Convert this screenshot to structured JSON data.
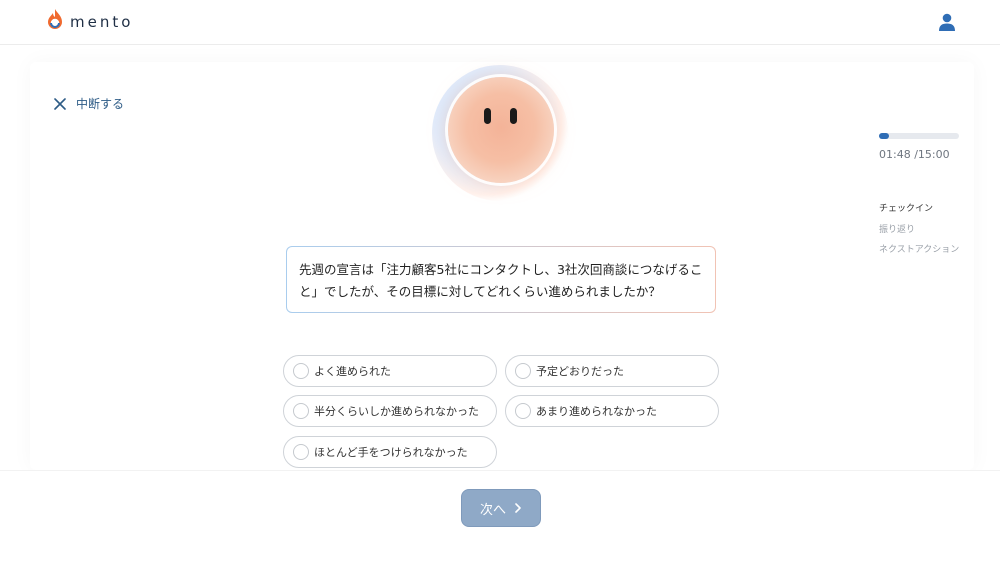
{
  "header": {
    "logo_text": "mento",
    "logo_icon": "mento-flame-logo",
    "user_icon": "user-icon"
  },
  "abort": {
    "label": "中断する",
    "icon": "close-icon"
  },
  "progress": {
    "fraction": 0.12,
    "elapsed": "01:48",
    "total": "/15:00",
    "steps": [
      "チェックイン",
      "振り返り",
      "ネクストアクション"
    ],
    "active_step": "チェックイン"
  },
  "question": {
    "text": "先週の宣言は「注力顧客5社にコンタクトし、3社次回商談につなげること」でしたが、その目標に対してどれくらい進められましたか？"
  },
  "options": [
    "よく進められた",
    "予定どおりだった",
    "半分くらいしか進められなかった",
    "あまり進められなかった",
    "ほとんど手をつけられなかった"
  ],
  "next_button": {
    "label": "次へ",
    "icon": "chevron-right-icon"
  },
  "colors": {
    "accent": "#2f6db5",
    "next_button_bg": "#8fa9c7",
    "link": "#2d5b86"
  }
}
